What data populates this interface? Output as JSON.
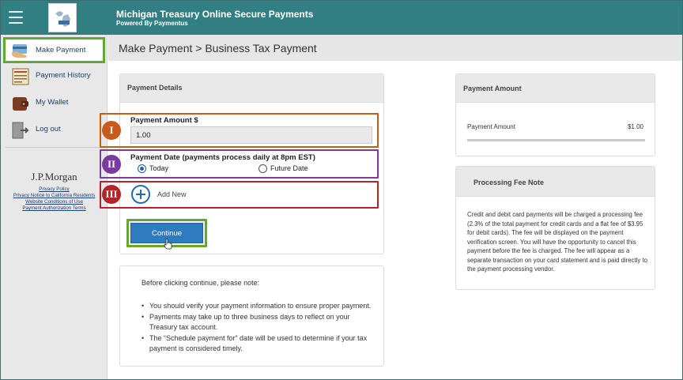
{
  "header": {
    "title": "Michigan Treasury Online Secure Payments",
    "subtitle": "Powered By Paymentus"
  },
  "sidebar": {
    "items": [
      {
        "label": "Make Payment",
        "icon": "hand-card-icon"
      },
      {
        "label": "Payment History",
        "icon": "payment-history-icon"
      },
      {
        "label": "My Wallet",
        "icon": "wallet-icon"
      },
      {
        "label": "Log out",
        "icon": "logout-icon"
      }
    ],
    "brand": "J.P.Morgan",
    "links": [
      "Privacy Policy",
      "Privacy Notice to California Residents",
      "Website Conditions of Use",
      "Payment Authorization Terms"
    ]
  },
  "page": {
    "title": "Make Payment > Business Tax Payment"
  },
  "payment_details": {
    "heading": "Payment Details",
    "amount_label": "Payment Amount $",
    "amount_value": "1.00",
    "date_label": "Payment Date (payments process daily at 8pm EST)",
    "date_options": [
      "Today",
      "Future Date"
    ],
    "date_selected": "Today",
    "add_new_label": "Add New",
    "continue_label": "Continue",
    "badges": [
      "I",
      "II",
      "III"
    ]
  },
  "notes": {
    "intro": "Before clicking continue, please note:",
    "bullets": [
      "You should verify your payment information to ensure proper payment.",
      "Payments may take up to three business days to reflect on your Treasury tax account.",
      "The “Schedule payment for” date will be used to determine if your tax payment is considered timely."
    ]
  },
  "payment_amount": {
    "heading": "Payment Amount",
    "label": "Payment Amount",
    "value": "$1.00"
  },
  "fee_note": {
    "heading": "Processing Fee Note",
    "text": "Credit and debit card payments will be charged a processing fee (2.3% of the total payment for credit cards and a flat fee of $3.95 for debit cards). The fee will be displayed on the payment verification screen. You will have the opportunity to cancel this payment before the fee is charged. The fee will appear as a separate transaction on your card statement and is paid directly to the payment processing vendor."
  },
  "colors": {
    "header": "#317f82",
    "highlight_green": "#66a82f",
    "highlight_orange": "#c85a1c",
    "highlight_purple": "#7a3aa0",
    "highlight_red": "#b32424",
    "button_blue": "#2f7bbf"
  }
}
